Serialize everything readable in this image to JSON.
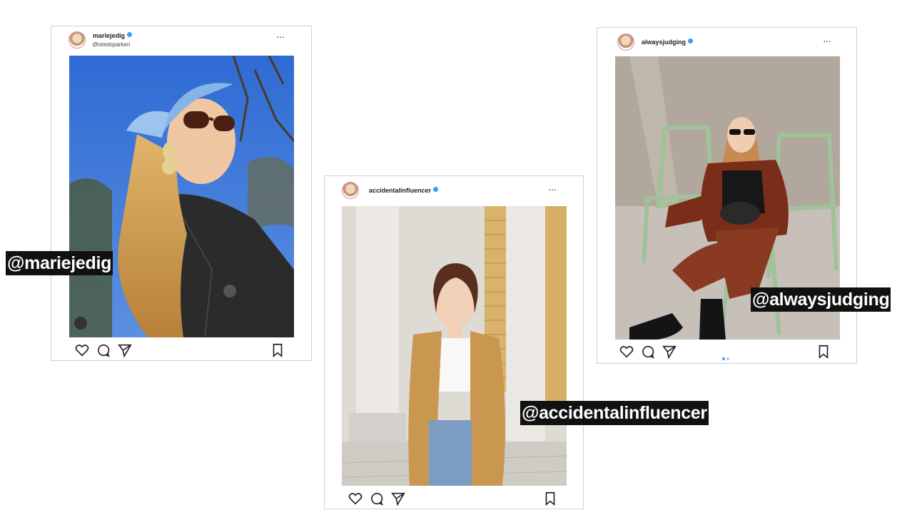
{
  "posts": [
    {
      "username": "mariejedig",
      "location": "Ørstedsparken",
      "more": "···",
      "handle_tag": "@mariejedig"
    },
    {
      "username": "accidentalinfluencer",
      "more": "···",
      "handle_tag": "@accidentalinfluencer"
    },
    {
      "username": "alwaysjudging",
      "more": "···",
      "handle_tag": "@alwaysjudging"
    }
  ],
  "icons": [
    "heart-icon",
    "comment-icon",
    "share-icon",
    "bookmark-icon",
    "more-icon",
    "user-tag-icon"
  ],
  "colors": {
    "verified": "#3d9bf0",
    "tag_bg": "#111111",
    "border": "#cfcfcf"
  }
}
